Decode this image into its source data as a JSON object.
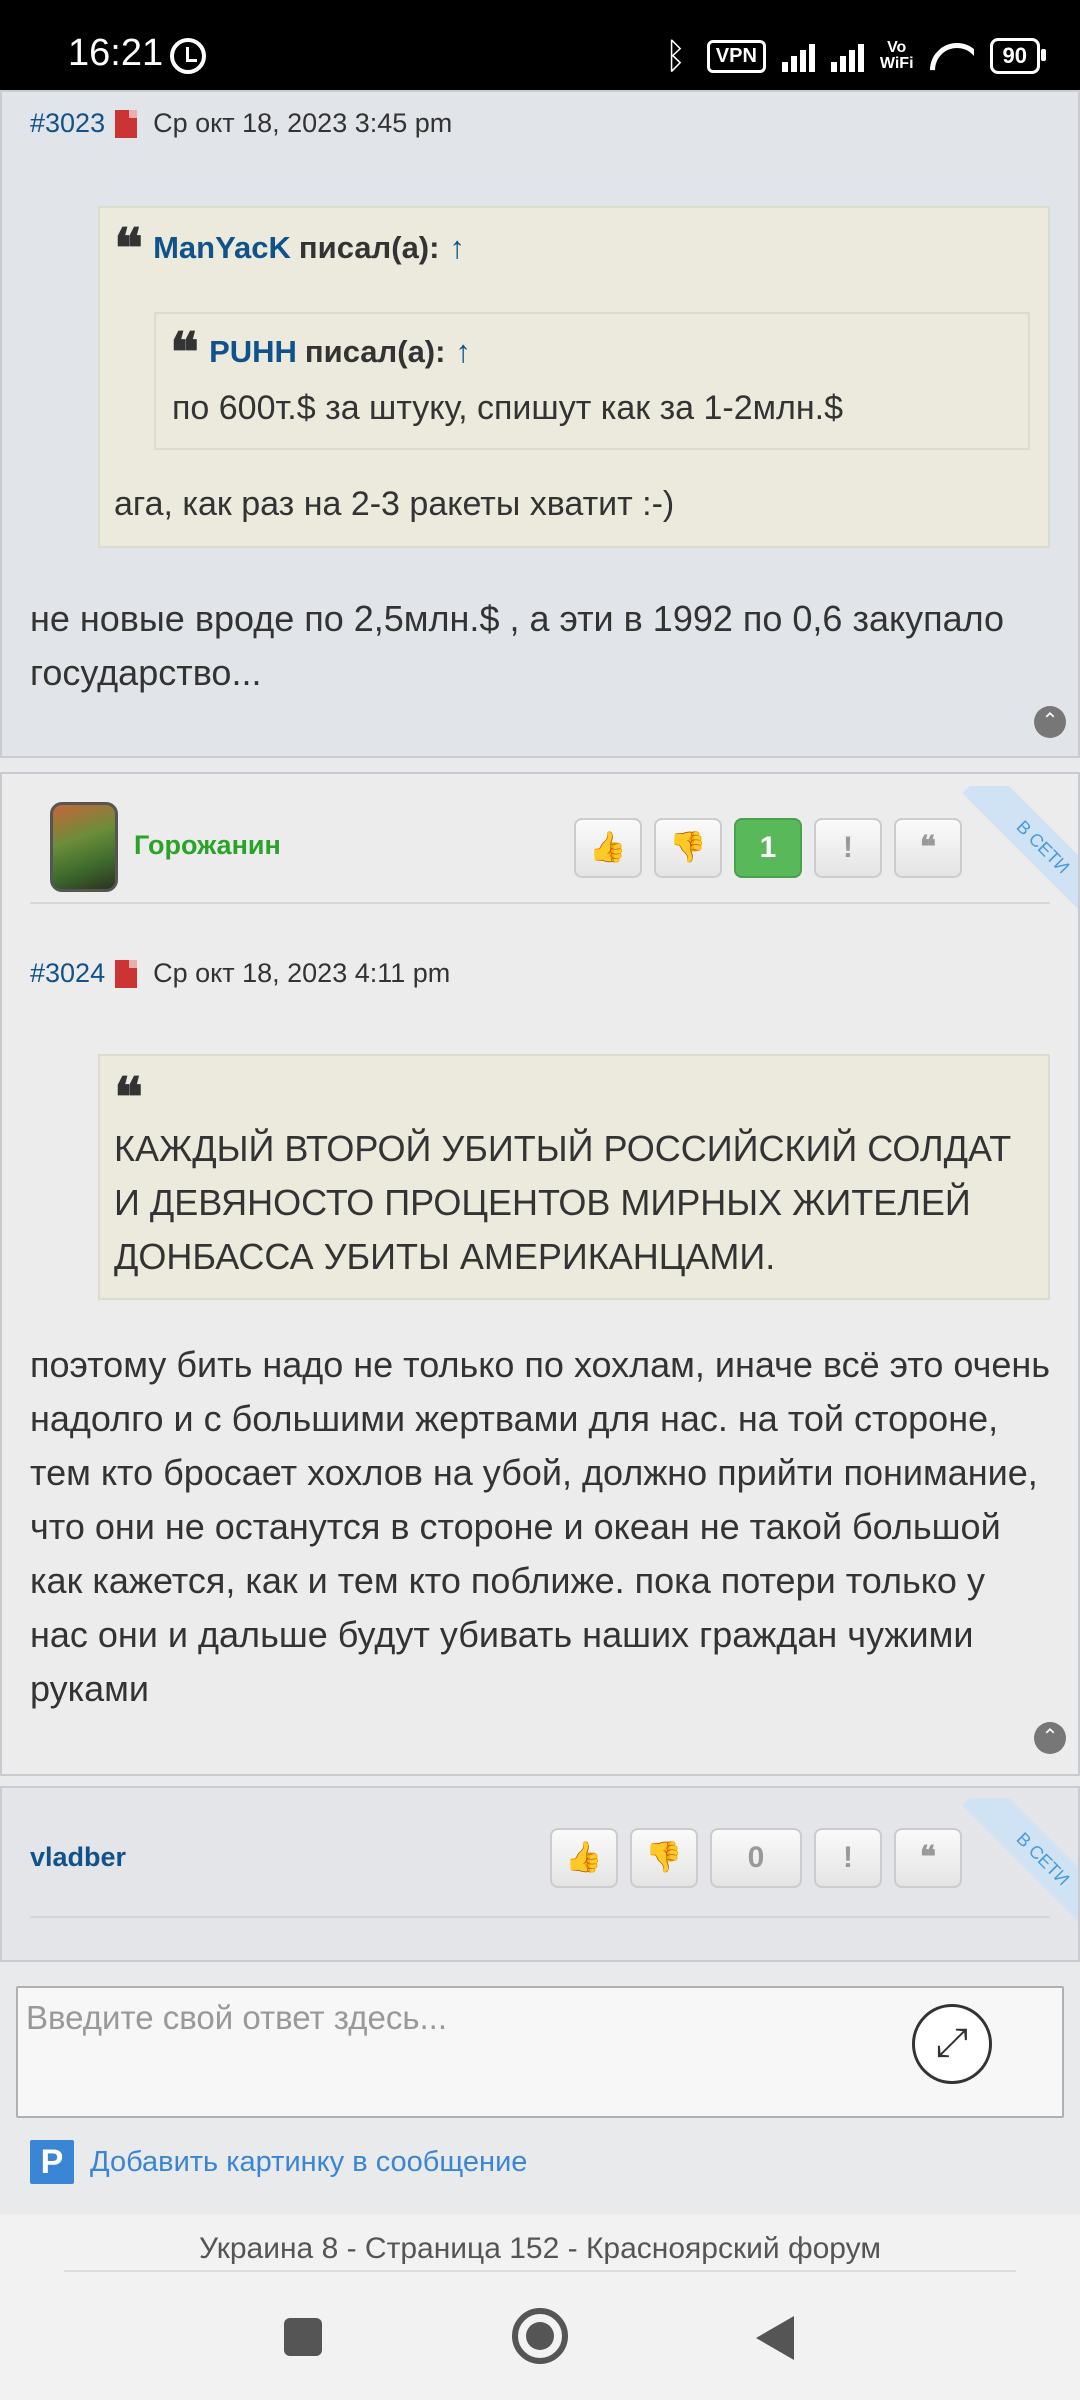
{
  "status_bar": {
    "time": "16:21",
    "vpn": "VPN",
    "volte": "Vo\nWiFi",
    "battery": "90"
  },
  "post1": {
    "number": "#3023",
    "date": "Ср окт 18, 2023 3:45 pm",
    "outer_quote": {
      "author": "ManYacK",
      "said": "писал(а):",
      "arrow": "↑",
      "text": "ага, как раз на 2-3 ракеты хватит :-)"
    },
    "inner_quote": {
      "author": "PUHH",
      "said": "писал(а):",
      "arrow": "↑",
      "text": "по 600т.$ за штуку, спишут как за 1-2млн.$"
    },
    "text": "не новые вроде по 2,5млн.$ , а эти в 1992 по 0,6 закупало государство..."
  },
  "post2": {
    "username": "Горожанин",
    "username_color": "#2aa32a",
    "reaction_count": "1",
    "online_label": "В СЕТИ",
    "number": "#3024",
    "date": "Ср окт 18, 2023 4:11 pm",
    "quote_text": "КАЖДЫЙ ВТОРОЙ УБИТЫЙ РОССИЙСКИЙ СОЛДАТ И ДЕВЯНОСТО ПРОЦЕНТОВ МИРНЫХ ЖИТЕЛЕЙ ДОНБАССА УБИТЫ АМЕРИКАНЦАМИ.",
    "text": "поэтому бить надо не только по хохлам, иначе всё это очень надолго и с большими жертвами для нас. на той стороне, тем кто бросает хохлов на убой, должно прийти понимание, что они не останутся в стороне и океан не такой большой как кажется, как и тем кто поближе. пока потери только у нас они и дальше будут убивать наших граждан чужими руками"
  },
  "post3": {
    "username": "vladber",
    "username_color": "#105289",
    "reaction_count": "0",
    "online_label": "В СЕТИ"
  },
  "reply": {
    "placeholder": "Введите свой ответ здесь...",
    "add_image_label": "Добавить картинку в сообщение"
  },
  "tab_title": "Украина 8 - Страница 152 - Красноярский форум"
}
